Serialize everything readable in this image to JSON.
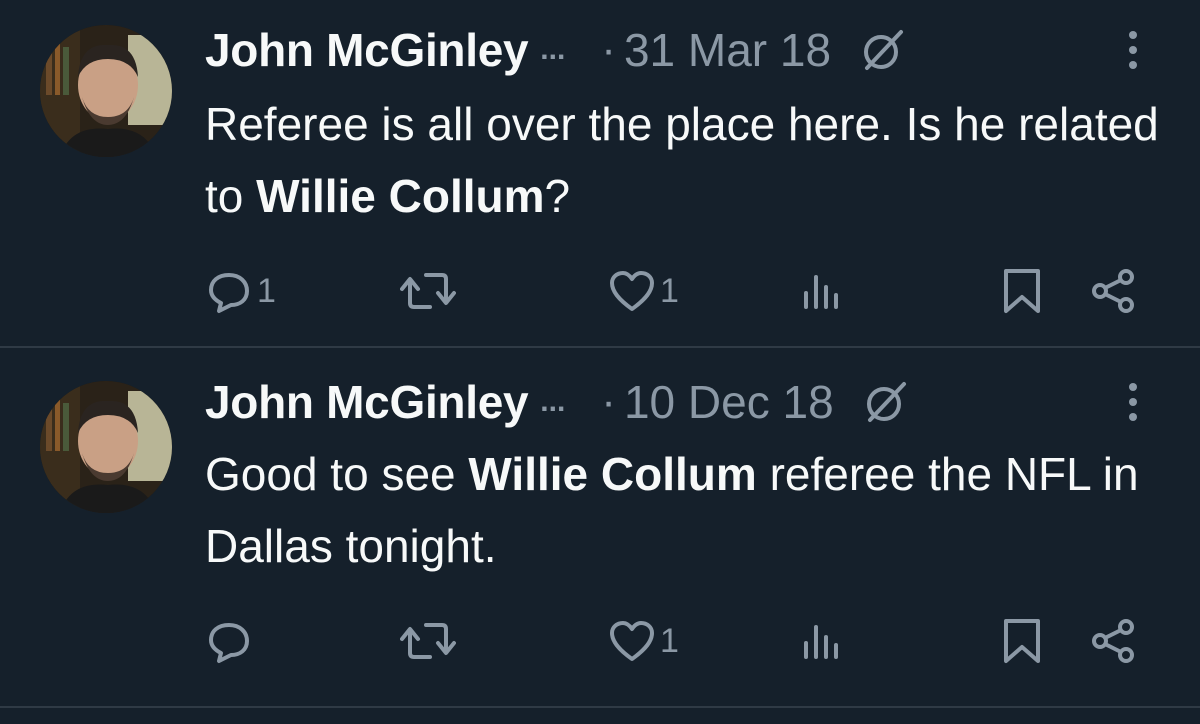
{
  "tweets": [
    {
      "author_name": "John McGinley",
      "ellipsis": "...",
      "separator": "·",
      "date": "31 Mar 18",
      "text_before": "Referee is all over the place here. Is he related to ",
      "text_bold": "Willie Collum",
      "text_after": "?",
      "reply_count": "1",
      "like_count": "1"
    },
    {
      "author_name": "John McGinley",
      "ellipsis": "...",
      "separator": "·",
      "date": "10 Dec 18",
      "text_before": "Good to see ",
      "text_bold": "Willie Collum",
      "text_after": " referee the NFL in Dallas tonight.",
      "reply_count": "",
      "like_count": "1"
    }
  ],
  "colors": {
    "background": "#15202b",
    "text_primary": "#f7f9f9",
    "text_secondary": "#8b98a5",
    "divider": "#2f3a45"
  },
  "icons": [
    "avatar-photo",
    "grok-icon",
    "more-icon",
    "reply-icon",
    "retweet-icon",
    "like-icon",
    "views-icon",
    "bookmark-icon",
    "share-icon"
  ]
}
